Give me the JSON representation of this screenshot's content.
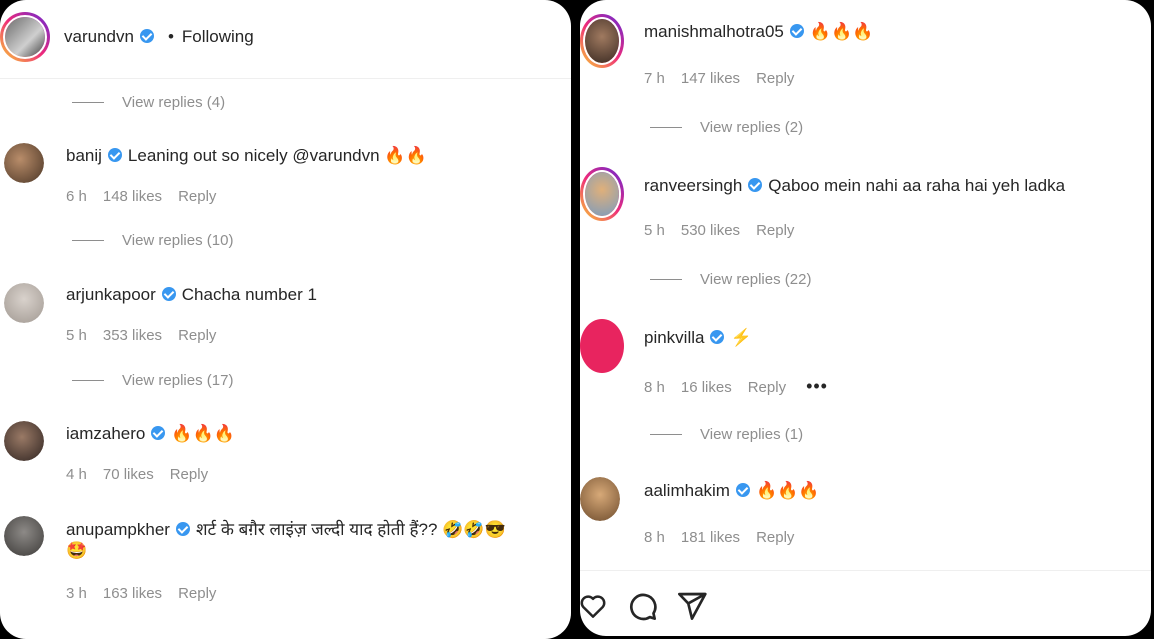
{
  "left": {
    "header": {
      "username": "varundvn",
      "dot": "•",
      "follow_label": "Following"
    },
    "top_view_replies": "View replies (4)",
    "comments": [
      {
        "username": "banij",
        "text": "Leaning out so nicely @varundvn 🔥🔥",
        "time": "6 h",
        "likes": "148 likes",
        "reply": "Reply",
        "view_replies": "View replies (10)"
      },
      {
        "username": "arjunkapoor",
        "text": "Chacha number 1",
        "time": "5 h",
        "likes": "353 likes",
        "reply": "Reply",
        "view_replies": "View replies (17)"
      },
      {
        "username": "iamzahero",
        "text": "🔥🔥🔥",
        "time": "4 h",
        "likes": "70 likes",
        "reply": "Reply"
      },
      {
        "username": "anupampkher",
        "text": "शर्ट के बग़ैर लाइंज़ जल्दी याद होती हैं?? 🤣🤣😎",
        "text2": "🤩",
        "time": "3 h",
        "likes": "163 likes",
        "reply": "Reply"
      }
    ]
  },
  "right": {
    "comments": [
      {
        "username": "manishmalhotra05",
        "text": "🔥🔥🔥",
        "time": "7 h",
        "likes": "147 likes",
        "reply": "Reply",
        "view_replies": "View replies (2)"
      },
      {
        "username": "ranveersingh",
        "text": "Qaboo mein nahi aa raha hai yeh ladka",
        "time": "5 h",
        "likes": "530 likes",
        "reply": "Reply",
        "view_replies": "View replies (22)"
      },
      {
        "username": "pinkvilla",
        "text": "⚡",
        "time": "8 h",
        "likes": "16 likes",
        "reply": "Reply",
        "more": "•••",
        "view_replies": "View replies (1)"
      },
      {
        "username": "aalimhakim",
        "text": "🔥🔥🔥",
        "time": "8 h",
        "likes": "181 likes",
        "reply": "Reply"
      }
    ],
    "actions": {
      "like_icon": "heart-icon",
      "comment_icon": "comment-icon",
      "share_icon": "share-icon"
    }
  },
  "colors": {
    "verified": "#3897f0",
    "meta": "#8e8e8e",
    "pinkvilla": "#e8245f"
  }
}
